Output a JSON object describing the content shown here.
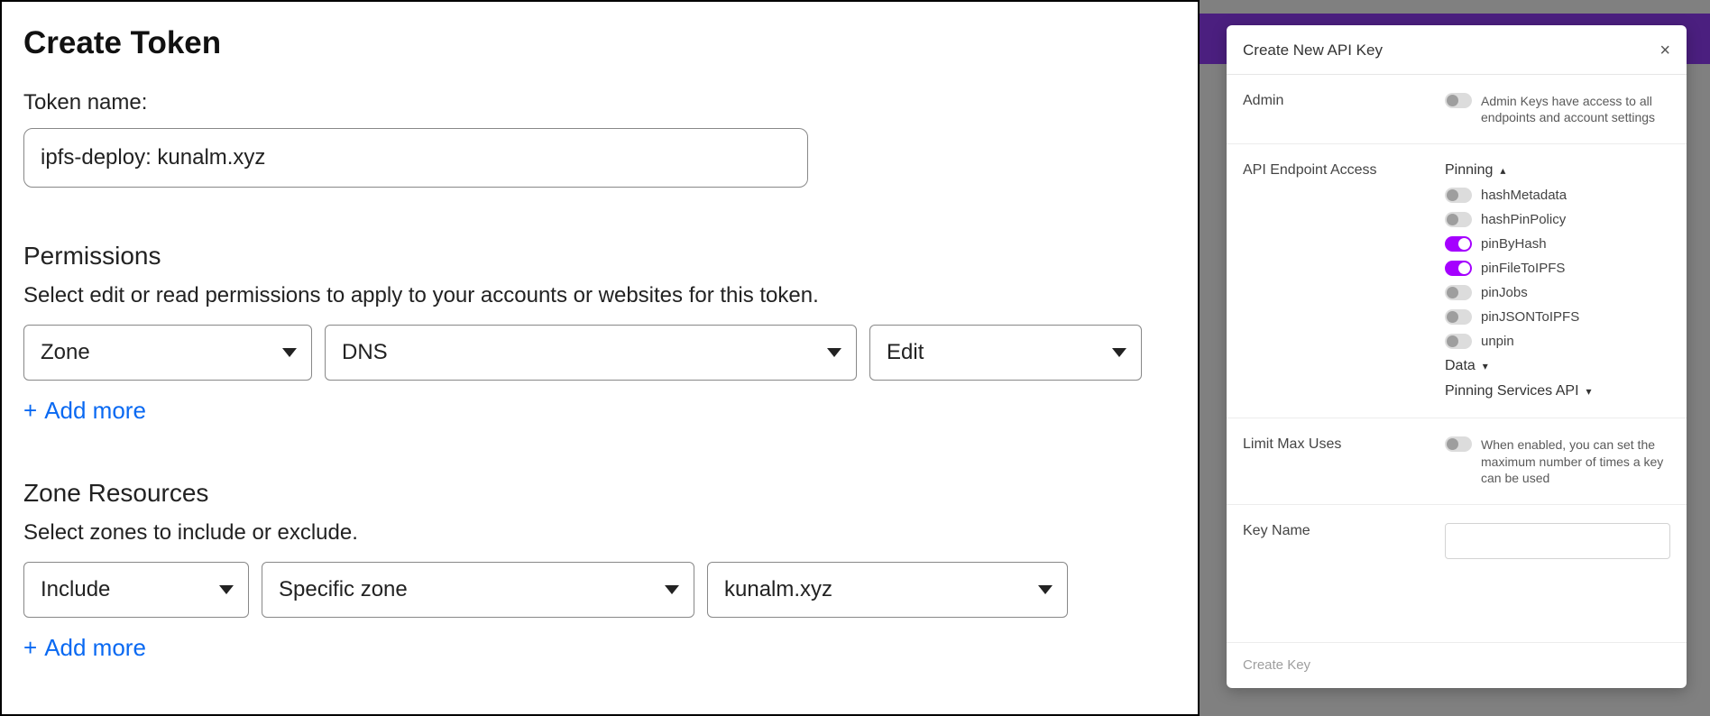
{
  "left": {
    "title": "Create Token",
    "token_name_label": "Token name:",
    "token_name_value": "ipfs-deploy: kunalm.xyz",
    "permissions": {
      "title": "Permissions",
      "help": "Select edit or read permissions to apply to your accounts or websites for this token.",
      "selects": {
        "scope": "Zone",
        "product": "DNS",
        "level": "Edit"
      },
      "add_more": "Add more"
    },
    "zone_resources": {
      "title": "Zone Resources",
      "help": "Select zones to include or exclude.",
      "selects": {
        "mode": "Include",
        "type": "Specific zone",
        "zone": "kunalm.xyz"
      },
      "add_more": "Add more"
    }
  },
  "right": {
    "modal_title": "Create New API Key",
    "admin": {
      "label": "Admin",
      "enabled": false,
      "help": "Admin Keys have access to all endpoints and account settings"
    },
    "api_access": {
      "label": "API Endpoint Access",
      "groups": [
        {
          "name": "Pinning",
          "expanded": true,
          "endpoints": [
            {
              "name": "hashMetadata",
              "enabled": false
            },
            {
              "name": "hashPinPolicy",
              "enabled": false
            },
            {
              "name": "pinByHash",
              "enabled": true
            },
            {
              "name": "pinFileToIPFS",
              "enabled": true
            },
            {
              "name": "pinJobs",
              "enabled": false
            },
            {
              "name": "pinJSONToIPFS",
              "enabled": false
            },
            {
              "name": "unpin",
              "enabled": false
            }
          ]
        },
        {
          "name": "Data",
          "expanded": false,
          "endpoints": []
        },
        {
          "name": "Pinning Services API",
          "expanded": false,
          "endpoints": []
        }
      ]
    },
    "limit_uses": {
      "label": "Limit Max Uses",
      "enabled": false,
      "help": "When enabled, you can set the maximum number of times a key can be used"
    },
    "key_name": {
      "label": "Key Name",
      "value": ""
    },
    "create_btn": "Create Key"
  }
}
